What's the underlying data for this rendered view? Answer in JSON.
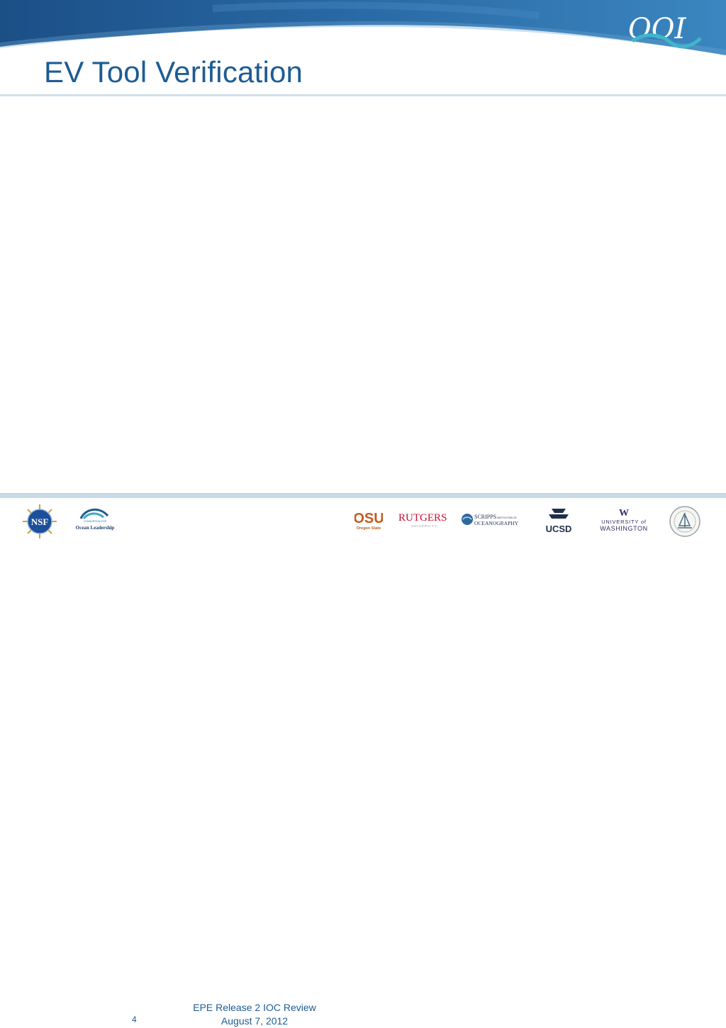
{
  "header": {
    "logo_text": "OOI",
    "colors": {
      "band_dark": "#1b4f86",
      "band_light": "#3f8cc4",
      "title": "#1d5c94",
      "rule": "#cfe0ea"
    }
  },
  "slide": {
    "title": "EV Tool Verification"
  },
  "footer": {
    "page_number": "4",
    "line1": "EPE Release 2 IOC Review",
    "line2": "August 7, 2012",
    "logos": {
      "nsf": "NSF",
      "ocean_leadership_top": "CONSORTIUM FOR",
      "ocean_leadership": "Ocean Leadership",
      "osu": "OSU",
      "osu_sub": "Oregon State",
      "rutgers": "RUTGERS",
      "rutgers_sub": "UNIVERSITY",
      "scripps": "SCRIPPS",
      "scripps_sub": "INSTITUTION OF",
      "scripps_main": "OCEANOGRAPHY",
      "ucsd": "UCSD",
      "uw_mark": "W",
      "uw_line1": "UNIVERSITY of",
      "uw_line2": "WASHINGTON"
    }
  }
}
